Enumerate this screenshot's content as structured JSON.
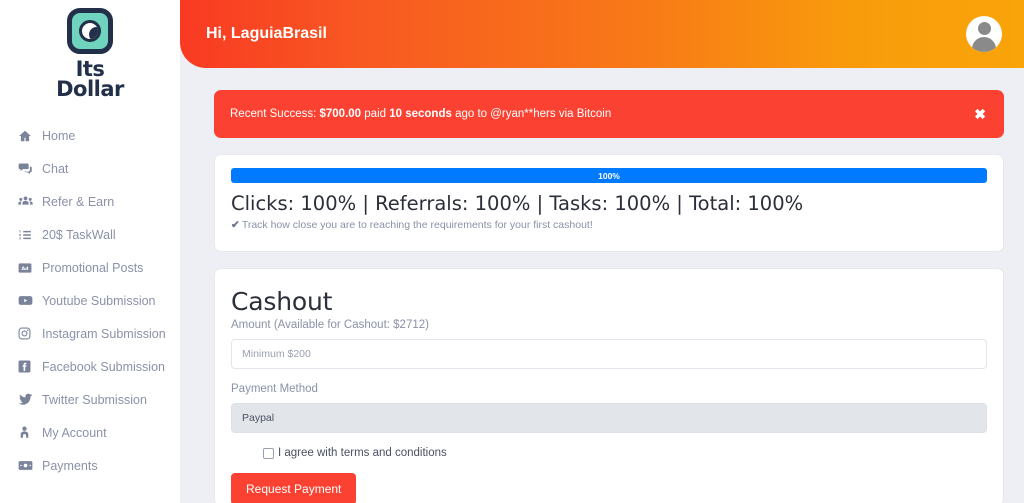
{
  "sidebar": {
    "logo": {
      "icon": "camera-lens-icon",
      "line1": "Its",
      "line2": "Dollar"
    },
    "items": [
      {
        "label": "Home",
        "icon": "home-icon"
      },
      {
        "label": "Chat",
        "icon": "chat-icon"
      },
      {
        "label": "Refer & Earn",
        "icon": "users-icon"
      },
      {
        "label": "20$ TaskWall",
        "icon": "list-ol-icon"
      },
      {
        "label": "Promotional Posts",
        "icon": "ad-icon"
      },
      {
        "label": "Youtube Submission",
        "icon": "youtube-icon"
      },
      {
        "label": "Instagram Submission",
        "icon": "instagram-icon"
      },
      {
        "label": "Facebook Submission",
        "icon": "facebook-icon"
      },
      {
        "label": "Twitter Submission",
        "icon": "twitter-icon"
      },
      {
        "label": "My Account",
        "icon": "user-tie-icon"
      },
      {
        "label": "Payments",
        "icon": "money-bill-icon"
      }
    ]
  },
  "header": {
    "greeting": "Hi, LaguiaBrasil",
    "avatar_icon": "user-avatar-icon",
    "gradient_start": "#f93a23",
    "gradient_end": "#f9a409"
  },
  "alert": {
    "prefix": "Recent Success:",
    "amount": "$700.00",
    "middle": "paid",
    "time": "10 seconds",
    "suffix": "ago to @ryan**hers via Bitcoin",
    "close_label": "✖",
    "background": "#fb4232"
  },
  "progress": {
    "percent_label": "100%",
    "percent_value": 100,
    "bar_color": "#007bff",
    "stats": "Clicks: 100% | Referrals: 100% | Tasks: 100% | Total: 100%",
    "check_icon": "✔",
    "note": "Track how close you are to reaching the requirements for your first cashout!"
  },
  "cashout": {
    "title": "Cashout",
    "amount_label": "Amount (Available for Cashout: $2712)",
    "amount_placeholder": "Minimum $200",
    "amount_value": "",
    "payment_label": "Payment Method",
    "payment_selected": "Paypal",
    "terms_text": "I agree with terms and conditions",
    "terms_checked": false,
    "submit_label": "Request Payment",
    "submit_color": "#fb4232"
  }
}
